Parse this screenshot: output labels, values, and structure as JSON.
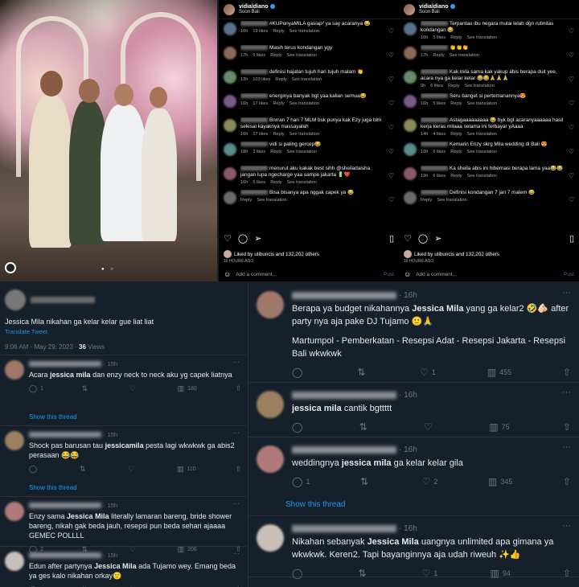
{
  "instagram": {
    "username": "vidialdiano",
    "location": "Soori Bali",
    "comments_left": [
      {
        "text": "#KUPunyaMILA gasiap² ya say acaranya 😂",
        "time": "10h",
        "likes": "19 likes"
      },
      {
        "text": "Masih terus kondangan ygy",
        "time": "17h",
        "likes": "5 likes"
      },
      {
        "text": "definisi hajatan tujuh hari tujuh malam 👏",
        "time": "13h",
        "likes": "103 likes"
      },
      {
        "text": "energinya banyak bgt yaa kalian semua😂",
        "time": "16h",
        "likes": "17 likes"
      },
      {
        "text": "Bnrran 7 hari 7 MLM bsk punya kak Ezy juga blm selesai kayaknya massayalah",
        "time": "16h",
        "likes": "17 likes"
      },
      {
        "text": "vidi si paling gercep😂",
        "time": "18h",
        "likes": "3 likes"
      },
      {
        "text": "menurut aku kakak best sihh @sheiladaisha jangan lupa ngecharge yaa sampe jakarta 🔋❤️",
        "time": "16h",
        "likes": "5 likes"
      },
      {
        "text": "Bisa bisanya apa nggak capek ya 😂",
        "time": "",
        "likes": ""
      }
    ],
    "comments_right": [
      {
        "text": "Terpantau ibu negara mulai lelah dgn rutinitas kondangan 😂",
        "time": "10h",
        "likes": "5 likes"
      },
      {
        "text": "👏👏👏",
        "time": "17h",
        "likes": ""
      },
      {
        "text": "Kak mila sama kak yakup abis berapa duit yee, acara nya ga kelar kelar 😂😂🙏🙏🙏",
        "time": "9h",
        "likes": "6 likes"
      },
      {
        "text": "Seru banget si pertemanannya😍",
        "time": "16h",
        "likes": "5 likes"
      },
      {
        "text": "Astagaaaaaaaaa 😂 byk bgt acaranyaaaaaa hasil kerja keras milaaa selama ini terbayar yAaaa",
        "time": "14h",
        "likes": "4 likes"
      },
      {
        "text": "Kemarin Enzy skrg Mila wedding di Bali 😍",
        "time": "10h",
        "likes": "6 likes"
      },
      {
        "text": "Ka sheila abis ini hibernasi berapa lama yaa😂😂",
        "time": "19h",
        "likes": "6 likes"
      },
      {
        "text": "Definisi kondangan 7 jari 7 malem 😂",
        "time": "",
        "likes": ""
      }
    ],
    "reply_label": "Reply",
    "see_translation": "See translation",
    "liked_by": "Liked by utibuncis and 132,202 others",
    "time_ago": "16 HOURS AGO",
    "add_comment": "Add a comment...",
    "post_label": "Post"
  },
  "twitter_left": {
    "main_tweet": "Jessica Mila nikahan ga kelar kelar gue liat liat",
    "translate": "Translate Tweet",
    "timestamp": "9:06 AM · May 29, 2023 · ",
    "views_count": "36",
    "views_label": "Views",
    "replies": [
      {
        "time": "15h",
        "pre": "Acara ",
        "bold": "jessica mila",
        "post": " dan enzy neck to neck aku yg capek liatnya",
        "reply": "1",
        "retweet": "",
        "like": "",
        "views": "180",
        "show_thread": "Show this thread"
      },
      {
        "time": "15h",
        "pre": "Shock pas barusan tau ",
        "bold": "jessicamila",
        "post": " pesta lagi wkwkwk ga abis2 perasaan 😂😂",
        "reply": "",
        "retweet": "",
        "like": "",
        "views": "110",
        "show_thread": "Show this thread"
      },
      {
        "time": "15h",
        "pre": "Enzy sama ",
        "bold": "Jessica Mila",
        "post": " literally lamaran bareng, bride shower bareng, nikah gak beda jauh, resepsi pun beda sehari ajaaaa GEMEC POLLLL",
        "reply": "2",
        "retweet": "",
        "like": "",
        "views": "206",
        "show_thread": ""
      },
      {
        "time": "15h",
        "pre": "Edun after partynya ",
        "bold": "Jessica Mila",
        "post": " ada Tujamo wey. Emang beda ya ges kalo nikahan orkay🙂",
        "reply": "1",
        "retweet": "",
        "like": "",
        "views": "136",
        "show_thread": ""
      }
    ]
  },
  "twitter_right": {
    "replies": [
      {
        "time": "16h",
        "pre": "Berapa ya budget nikahannya ",
        "bold": "Jessica Mila",
        "post": " yang ga kelar2 🤣🫵🏻 after party nya aja pake DJ Tujamo 🙂🙏",
        "extra": "Martumpol - Pemberkatan - Resepsi Adat - Resepsi Jakarta - Resepsi Bali wkwkwk",
        "reply": "",
        "retweet": "",
        "like": "1",
        "views": "455",
        "show_thread": ""
      },
      {
        "time": "16h",
        "pre": "",
        "bold": "jessica mila",
        "post": " cantik bgttttt",
        "extra": "",
        "reply": "",
        "retweet": "",
        "like": "",
        "views": "75",
        "show_thread": ""
      },
      {
        "time": "16h",
        "pre": "weddingnya ",
        "bold": "jessica mila",
        "post": " ga kelar kelar gila",
        "extra": "",
        "reply": "1",
        "retweet": "",
        "like": "2",
        "views": "345",
        "show_thread": "Show this thread"
      },
      {
        "time": "16h",
        "pre": "Nikahan sebanyak ",
        "bold": "Jessica Mila",
        "post": " uangnya unlimited apa gimana ya wkwkwk. Keren2. Tapi bayanginnya aja udah riweuh ✨👍",
        "extra": "",
        "reply": "",
        "retweet": "",
        "like": "1",
        "views": "94",
        "show_thread": ""
      }
    ]
  },
  "colors": {
    "twitter_bg": "#15202b",
    "link_blue": "#1d9bf0",
    "like_pink": "#f91880",
    "instagram_bg": "#000000"
  }
}
